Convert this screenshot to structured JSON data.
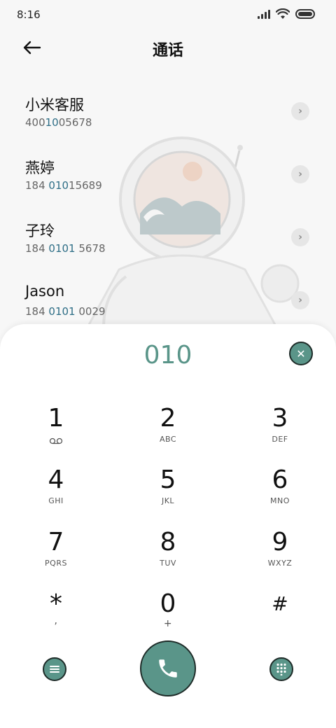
{
  "status_bar": {
    "time": "8:16"
  },
  "header": {
    "title": "通话"
  },
  "contacts": [
    {
      "name": "小米客服",
      "number_pre": "400",
      "number_hl": "10",
      "number_post": "05678"
    },
    {
      "name": "燕婷",
      "number_pre": "184 ",
      "number_hl": "010",
      "number_post": "15689"
    },
    {
      "name": "子玲",
      "number_pre": "184 ",
      "number_hl": "0101",
      "number_post": " 5678"
    },
    {
      "name": "Jason",
      "number_pre": "184 ",
      "number_hl": "0101",
      "number_post": " 0029"
    }
  ],
  "dialer": {
    "input_value": "010",
    "keys": [
      {
        "digit": "1",
        "sub": ""
      },
      {
        "digit": "2",
        "sub": "ABC"
      },
      {
        "digit": "3",
        "sub": "DEF"
      },
      {
        "digit": "4",
        "sub": "GHI"
      },
      {
        "digit": "5",
        "sub": "JKL"
      },
      {
        "digit": "6",
        "sub": "MNO"
      },
      {
        "digit": "7",
        "sub": "PQRS"
      },
      {
        "digit": "8",
        "sub": "TUV"
      },
      {
        "digit": "9",
        "sub": "WXYZ"
      },
      {
        "digit": "*",
        "sub": ","
      },
      {
        "digit": "0",
        "sub": "+"
      },
      {
        "digit": "#",
        "sub": ""
      }
    ]
  },
  "icons": {
    "back": "arrow-left-icon",
    "chevron": "chevron-right-icon",
    "clear": "close-icon",
    "voicemail": "voicemail-icon",
    "menu": "menu-icon",
    "call": "phone-icon",
    "keypad": "dialpad-icon"
  },
  "colors": {
    "accent": "#5a9589",
    "highlight": "#2e6e86"
  }
}
